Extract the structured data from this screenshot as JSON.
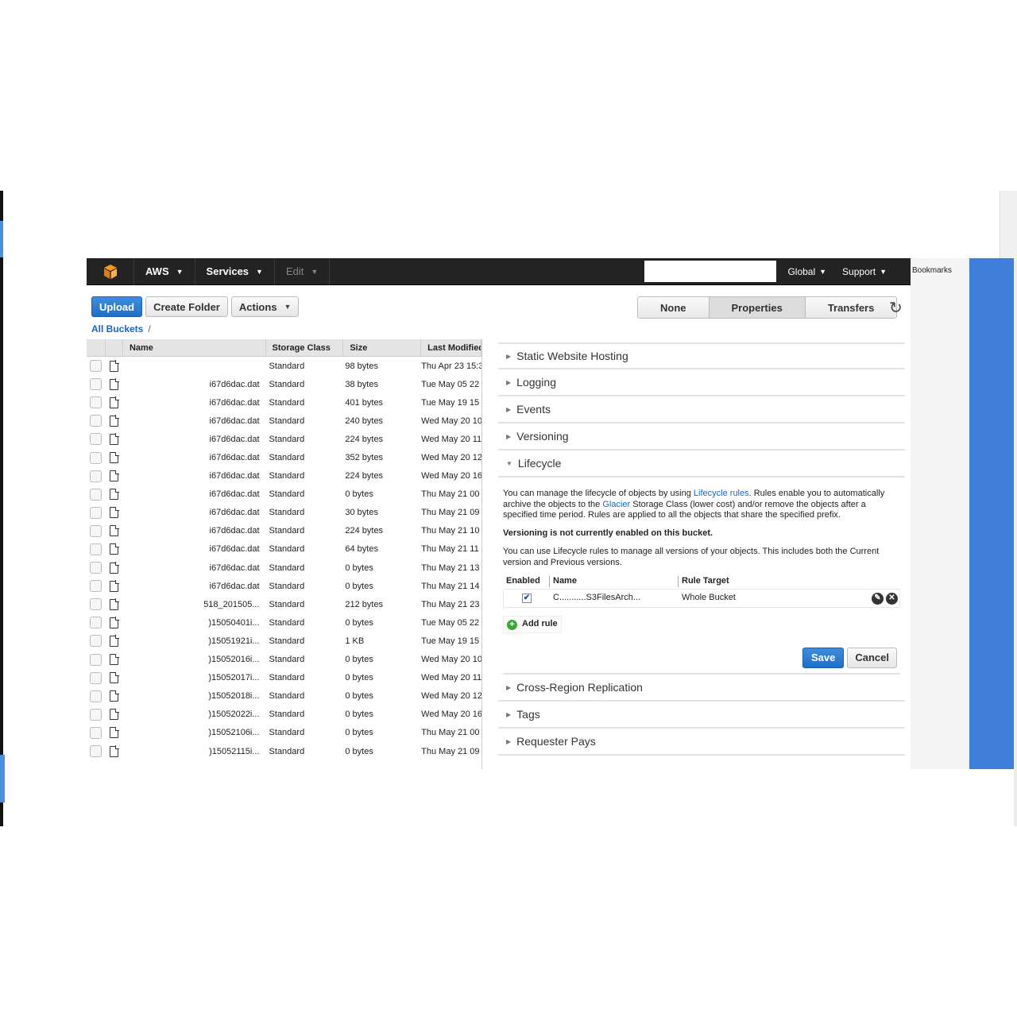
{
  "browser": {
    "bookmarks_label": "Bookmarks"
  },
  "navbar": {
    "aws_label": "AWS",
    "services_label": "Services",
    "edit_label": "Edit",
    "region_label": "Global",
    "support_label": "Support",
    "search_value": ""
  },
  "toolbar": {
    "upload_label": "Upload",
    "create_folder_label": "Create Folder",
    "actions_label": "Actions"
  },
  "view_tabs": {
    "none_label": "None",
    "properties_label": "Properties",
    "transfers_label": "Transfers"
  },
  "breadcrumb": {
    "all_buckets_label": "All Buckets",
    "separator": "/"
  },
  "object_list": {
    "columns": {
      "name": "Name",
      "storage_class": "Storage Class",
      "size": "Size",
      "last_modified": "Last Modified"
    },
    "rows": [
      {
        "name": "",
        "storage_class": "Standard",
        "size": "98 bytes",
        "last_modified": "Thu Apr 23 15:3"
      },
      {
        "name": "i67d6dac.dat",
        "storage_class": "Standard",
        "size": "38 bytes",
        "last_modified": "Tue May 05 22"
      },
      {
        "name": "i67d6dac.dat",
        "storage_class": "Standard",
        "size": "401 bytes",
        "last_modified": "Tue May 19 15"
      },
      {
        "name": "i67d6dac.dat",
        "storage_class": "Standard",
        "size": "240 bytes",
        "last_modified": "Wed May 20 10"
      },
      {
        "name": "i67d6dac.dat",
        "storage_class": "Standard",
        "size": "224 bytes",
        "last_modified": "Wed May 20 11"
      },
      {
        "name": "i67d6dac.dat",
        "storage_class": "Standard",
        "size": "352 bytes",
        "last_modified": "Wed May 20 12"
      },
      {
        "name": "i67d6dac.dat",
        "storage_class": "Standard",
        "size": "224 bytes",
        "last_modified": "Wed May 20 16"
      },
      {
        "name": "i67d6dac.dat",
        "storage_class": "Standard",
        "size": "0 bytes",
        "last_modified": "Thu May 21 00"
      },
      {
        "name": "i67d6dac.dat",
        "storage_class": "Standard",
        "size": "30 bytes",
        "last_modified": "Thu May 21 09"
      },
      {
        "name": "i67d6dac.dat",
        "storage_class": "Standard",
        "size": "224 bytes",
        "last_modified": "Thu May 21 10"
      },
      {
        "name": "i67d6dac.dat",
        "storage_class": "Standard",
        "size": "64 bytes",
        "last_modified": "Thu May 21 11"
      },
      {
        "name": "i67d6dac.dat",
        "storage_class": "Standard",
        "size": "0 bytes",
        "last_modified": "Thu May 21 13"
      },
      {
        "name": "i67d6dac.dat",
        "storage_class": "Standard",
        "size": "0 bytes",
        "last_modified": "Thu May 21 14"
      },
      {
        "name": "518_201505...",
        "storage_class": "Standard",
        "size": "212 bytes",
        "last_modified": "Thu May 21 23"
      },
      {
        "name": ")15050401i...",
        "storage_class": "Standard",
        "size": "0 bytes",
        "last_modified": "Tue May 05 22"
      },
      {
        "name": ")15051921i...",
        "storage_class": "Standard",
        "size": "1 KB",
        "last_modified": "Tue May 19 15"
      },
      {
        "name": ")15052016i...",
        "storage_class": "Standard",
        "size": "0 bytes",
        "last_modified": "Wed May 20 10"
      },
      {
        "name": ")15052017i...",
        "storage_class": "Standard",
        "size": "0 bytes",
        "last_modified": "Wed May 20 11"
      },
      {
        "name": ")15052018i...",
        "storage_class": "Standard",
        "size": "0 bytes",
        "last_modified": "Wed May 20 12"
      },
      {
        "name": ")15052022i...",
        "storage_class": "Standard",
        "size": "0 bytes",
        "last_modified": "Wed May 20 16"
      },
      {
        "name": ")15052106i...",
        "storage_class": "Standard",
        "size": "0 bytes",
        "last_modified": "Thu May 21 00"
      },
      {
        "name": ")15052115i...",
        "storage_class": "Standard",
        "size": "0 bytes",
        "last_modified": "Thu May 21 09"
      }
    ]
  },
  "properties": {
    "sections_before": [
      "Static Website Hosting",
      "Logging",
      "Events",
      "Versioning"
    ],
    "lifecycle": {
      "title": "Lifecycle",
      "intro_1": "You can manage the lifecycle of objects by using ",
      "link_lifecycle_rules": "Lifecycle rules",
      "intro_2": ". Rules enable you to automatically archive the objects to the ",
      "link_glacier": "Glacier",
      "intro_3": " Storage Class (lower cost) and/or remove the objects after a specified time period. Rules are applied to all the objects that share the specified prefix.",
      "versioning_warning": "Versioning is not currently enabled on this bucket.",
      "versions_note": "You can use Lifecycle rules to manage all versions of your objects. This includes both the Current version and Previous versions.",
      "rules_columns": {
        "enabled": "Enabled",
        "name": "Name",
        "target": "Rule Target"
      },
      "rule": {
        "enabled_mark": "✔",
        "name": "C...........S3FilesArch...",
        "target": "Whole Bucket"
      },
      "add_rule_label": "Add rule",
      "save_label": "Save",
      "cancel_label": "Cancel"
    },
    "sections_after": [
      "Cross-Region Replication",
      "Tags",
      "Requester Pays"
    ]
  },
  "colors": {
    "navbar_bg": "#232323",
    "primary_blue": "#1f6fc8",
    "link_blue": "#1a66c8",
    "aws_orange": "#f7981d"
  }
}
